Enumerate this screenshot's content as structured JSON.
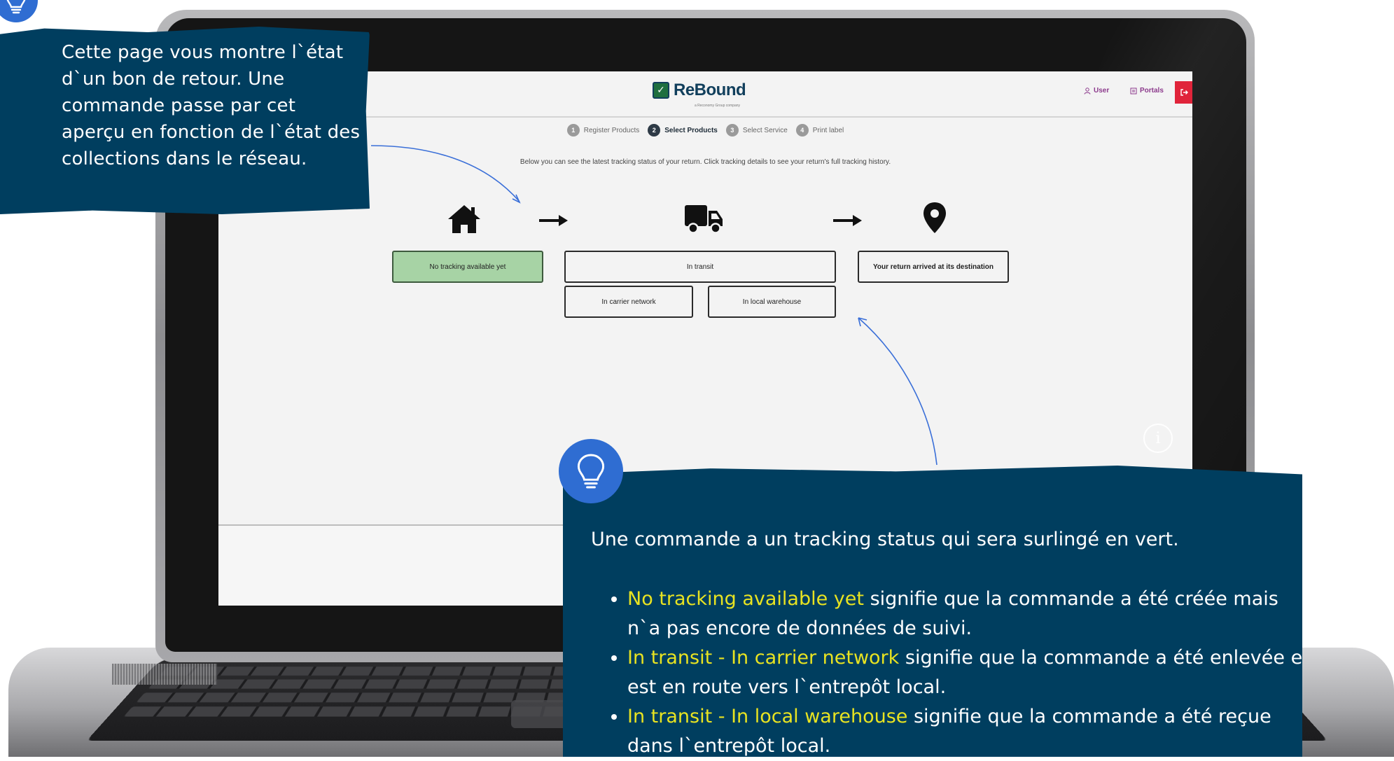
{
  "app": {
    "logo_mark": "✓",
    "logo_name": "ReBound",
    "logo_sub": "a Reconomy Group company",
    "nav_user": "User",
    "nav_portals": "Portals",
    "logout_icon": "logout-icon"
  },
  "steps": [
    {
      "num": "1",
      "label": "Register Products",
      "active": false
    },
    {
      "num": "2",
      "label": "Select Products",
      "active": true
    },
    {
      "num": "3",
      "label": "Select Service",
      "active": false
    },
    {
      "num": "4",
      "label": "Print label",
      "active": false
    }
  ],
  "intro": "Below you can see the latest tracking status of your return. Click tracking details to see your return's full tracking history.",
  "tracking": {
    "icons": [
      "home-icon",
      "truck-icon",
      "location-pin-icon"
    ],
    "statuses": {
      "no_tracking": "No tracking available yet",
      "in_transit": "In transit",
      "in_carrier": "In carrier network",
      "in_local": "In local warehouse",
      "arrived": "Your return arrived at its destination"
    },
    "active_status": "No tracking available yet",
    "active_color": "#a7d3a5"
  },
  "callouts": {
    "top": {
      "text": "Cette page vous montre l`état d`un bon de retour. Une commande passe par cet aperçu en fonction de l`état des collections dans le réseau."
    },
    "bottom": {
      "lead": "Une commande a un tracking status qui sera surlingé en vert.",
      "items": [
        {
          "highlight": "No tracking available yet",
          "rest": " signifie que la commande a été créée mais n`a pas encore de données de suivi."
        },
        {
          "highlight": "In transit - In carrier network",
          "rest": " signifie que la commande a été enlevée et est en route vers l`entrepôt local."
        },
        {
          "highlight": "In transit - In local warehouse",
          "rest": " signifie que la commande a été reçue dans l`entrepôt local."
        }
      ]
    }
  },
  "colors": {
    "callout_bg": "#003e5f",
    "highlight": "#e8e321",
    "bulb_badge": "#2f6dd2",
    "connector": "#3a6fd8",
    "logout": "#e0243a",
    "brand": "#113f5c"
  }
}
